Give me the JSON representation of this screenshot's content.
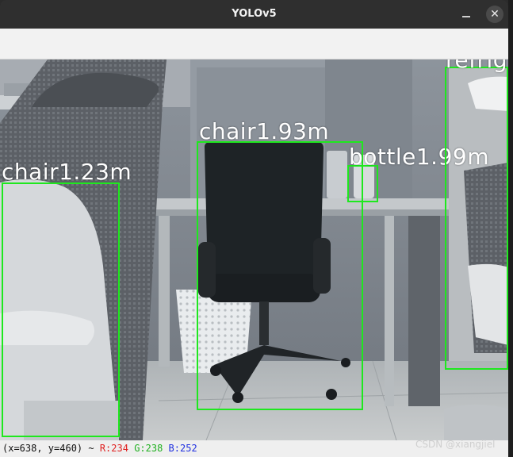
{
  "window": {
    "title": "YOLOv5",
    "close_glyph": "✕"
  },
  "detections": [
    {
      "label": "chair1.23m",
      "class": "chair",
      "distance_m": 1.23
    },
    {
      "label": "chair1.93m",
      "class": "chair",
      "distance_m": 1.93
    },
    {
      "label": "bottle1.99m",
      "class": "bottle",
      "distance_m": 1.99
    },
    {
      "label": "refrig",
      "class": "refrigerator"
    }
  ],
  "statusbar": {
    "coords": "(x=638, y=460) ~",
    "r": "R:234",
    "g": "G:238",
    "b": "B:252"
  },
  "watermark": "CSDN @xiangjiel",
  "colors": {
    "box": "#1ee81e",
    "label_text": "#ffffff",
    "titlebar": "#2f2f2f",
    "r": "#e02020",
    "g": "#20b020",
    "b": "#2030e0"
  }
}
